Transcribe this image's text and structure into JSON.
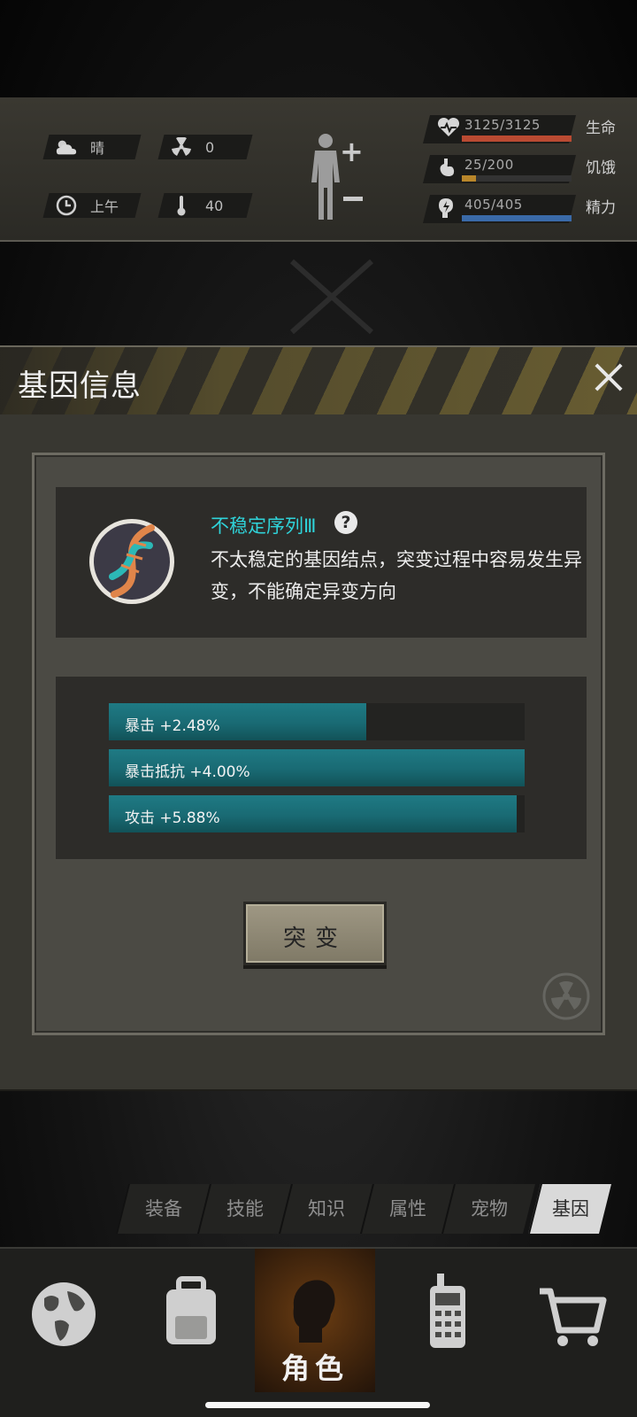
{
  "status": {
    "weather": "晴",
    "radiation": "0",
    "time_of_day": "上午",
    "temperature": "40",
    "vitals": [
      {
        "icon": "heart-icon",
        "value": "3125/3125",
        "label": "生命",
        "fill": 1.0,
        "color": "#b94a32"
      },
      {
        "icon": "stomach-icon",
        "value": "25/200",
        "label": "饥饿",
        "fill": 0.125,
        "color": "#b8862a"
      },
      {
        "icon": "energy-icon",
        "value": "405/405",
        "label": "精力",
        "fill": 1.0,
        "color": "#3a6aa8"
      }
    ]
  },
  "dialog": {
    "title": "基因信息",
    "gene": {
      "name": "不稳定序列Ⅲ",
      "description": "不太稳定的基因结点，突变过程中容易发生异变，不能确定异变方向"
    },
    "stats": [
      {
        "label": "暴击 +2.48%",
        "fill": 0.62
      },
      {
        "label": "暴击抵抗 +4.00%",
        "fill": 1.0
      },
      {
        "label": "攻击 +5.88%",
        "fill": 0.98
      }
    ],
    "mutate_button": "突变"
  },
  "tabs": [
    {
      "label": "装备",
      "active": false
    },
    {
      "label": "技能",
      "active": false
    },
    {
      "label": "知识",
      "active": false
    },
    {
      "label": "属性",
      "active": false
    },
    {
      "label": "宠物",
      "active": false
    },
    {
      "label": "基因",
      "active": true
    }
  ],
  "nav": {
    "active_label": "角色",
    "items": [
      "globe-icon",
      "backpack-icon",
      "character-icon",
      "radio-icon",
      "cart-icon"
    ]
  },
  "colors": {
    "accent_cyan": "#2fd3d9",
    "stat_bar": "#1f7a84",
    "active_nav": "#6b3d12"
  }
}
